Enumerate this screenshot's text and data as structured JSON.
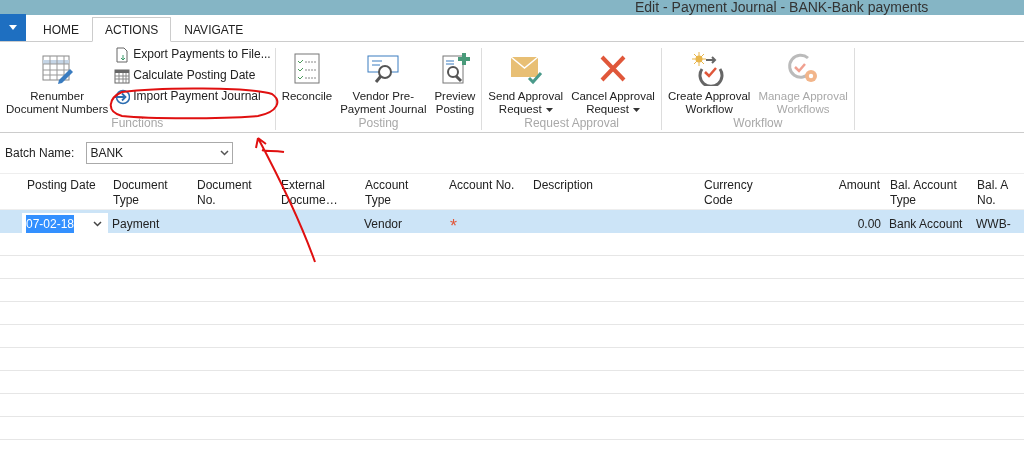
{
  "window": {
    "title": "Edit - Payment Journal - BANK-Bank payments"
  },
  "tabs": [
    {
      "label": "HOME",
      "selected": false
    },
    {
      "label": "ACTIONS",
      "selected": true
    },
    {
      "label": "NAVIGATE",
      "selected": false
    }
  ],
  "ribbon": {
    "groups": [
      {
        "label": "Functions",
        "items": [
          {
            "kind": "large",
            "lines": [
              "Renumber",
              "Document Numbers"
            ],
            "dropdown": false,
            "disabled": false
          },
          {
            "kind": "small",
            "lines": [
              "Export Payments to File..."
            ],
            "dropdown": false,
            "disabled": false
          },
          {
            "kind": "small",
            "lines": [
              "Calculate Posting Date"
            ],
            "dropdown": false,
            "disabled": false
          },
          {
            "kind": "small",
            "lines": [
              "Import Payment Journal"
            ],
            "dropdown": false,
            "disabled": false
          }
        ]
      },
      {
        "label": "Posting",
        "items": [
          {
            "kind": "large",
            "lines": [
              "Reconcile"
            ],
            "dropdown": false,
            "disabled": false
          },
          {
            "kind": "large",
            "lines": [
              "Vendor Pre-",
              "Payment Journal"
            ],
            "dropdown": false,
            "disabled": false
          },
          {
            "kind": "large",
            "lines": [
              "Preview",
              "Posting"
            ],
            "dropdown": false,
            "disabled": false
          }
        ]
      },
      {
        "label": "Request Approval",
        "items": [
          {
            "kind": "large",
            "lines": [
              "Send Approval",
              "Request"
            ],
            "dropdown": true,
            "disabled": false
          },
          {
            "kind": "large",
            "lines": [
              "Cancel Approval",
              "Request"
            ],
            "dropdown": true,
            "disabled": false
          }
        ]
      },
      {
        "label": "Workflow",
        "items": [
          {
            "kind": "large",
            "lines": [
              "Create Approval",
              "Workflow"
            ],
            "dropdown": false,
            "disabled": false
          },
          {
            "kind": "large",
            "lines": [
              "Manage Approval",
              "Workflows"
            ],
            "dropdown": false,
            "disabled": true
          }
        ]
      }
    ]
  },
  "batch": {
    "label": "Batch Name:",
    "value": "BANK"
  },
  "table": {
    "columns": [
      {
        "lines": [
          "Posting Date"
        ],
        "kind": "text"
      },
      {
        "lines": [
          "Document",
          "Type"
        ],
        "kind": "text"
      },
      {
        "lines": [
          "Document",
          "No."
        ],
        "kind": "text"
      },
      {
        "lines": [
          "External",
          "Docume…"
        ],
        "kind": "text"
      },
      {
        "lines": [
          "Account",
          "Type"
        ],
        "kind": "text"
      },
      {
        "lines": [
          "Account No."
        ],
        "kind": "text"
      },
      {
        "lines": [
          "Description"
        ],
        "kind": "text"
      },
      {
        "lines": [
          "Currency",
          "Code"
        ],
        "kind": "text"
      },
      {
        "lines": [
          "Amount"
        ],
        "kind": "number"
      },
      {
        "lines": [
          "Bal. Account",
          "Type"
        ],
        "kind": "text"
      },
      {
        "lines": [
          "Bal. A",
          "No."
        ],
        "kind": "text"
      }
    ],
    "rows": [
      {
        "selected": true,
        "cells": [
          "07-02-18",
          "Payment",
          "",
          "",
          "Vendor",
          "*",
          "",
          "",
          "0.00",
          "Bank Account",
          "WWB-"
        ]
      }
    ]
  }
}
